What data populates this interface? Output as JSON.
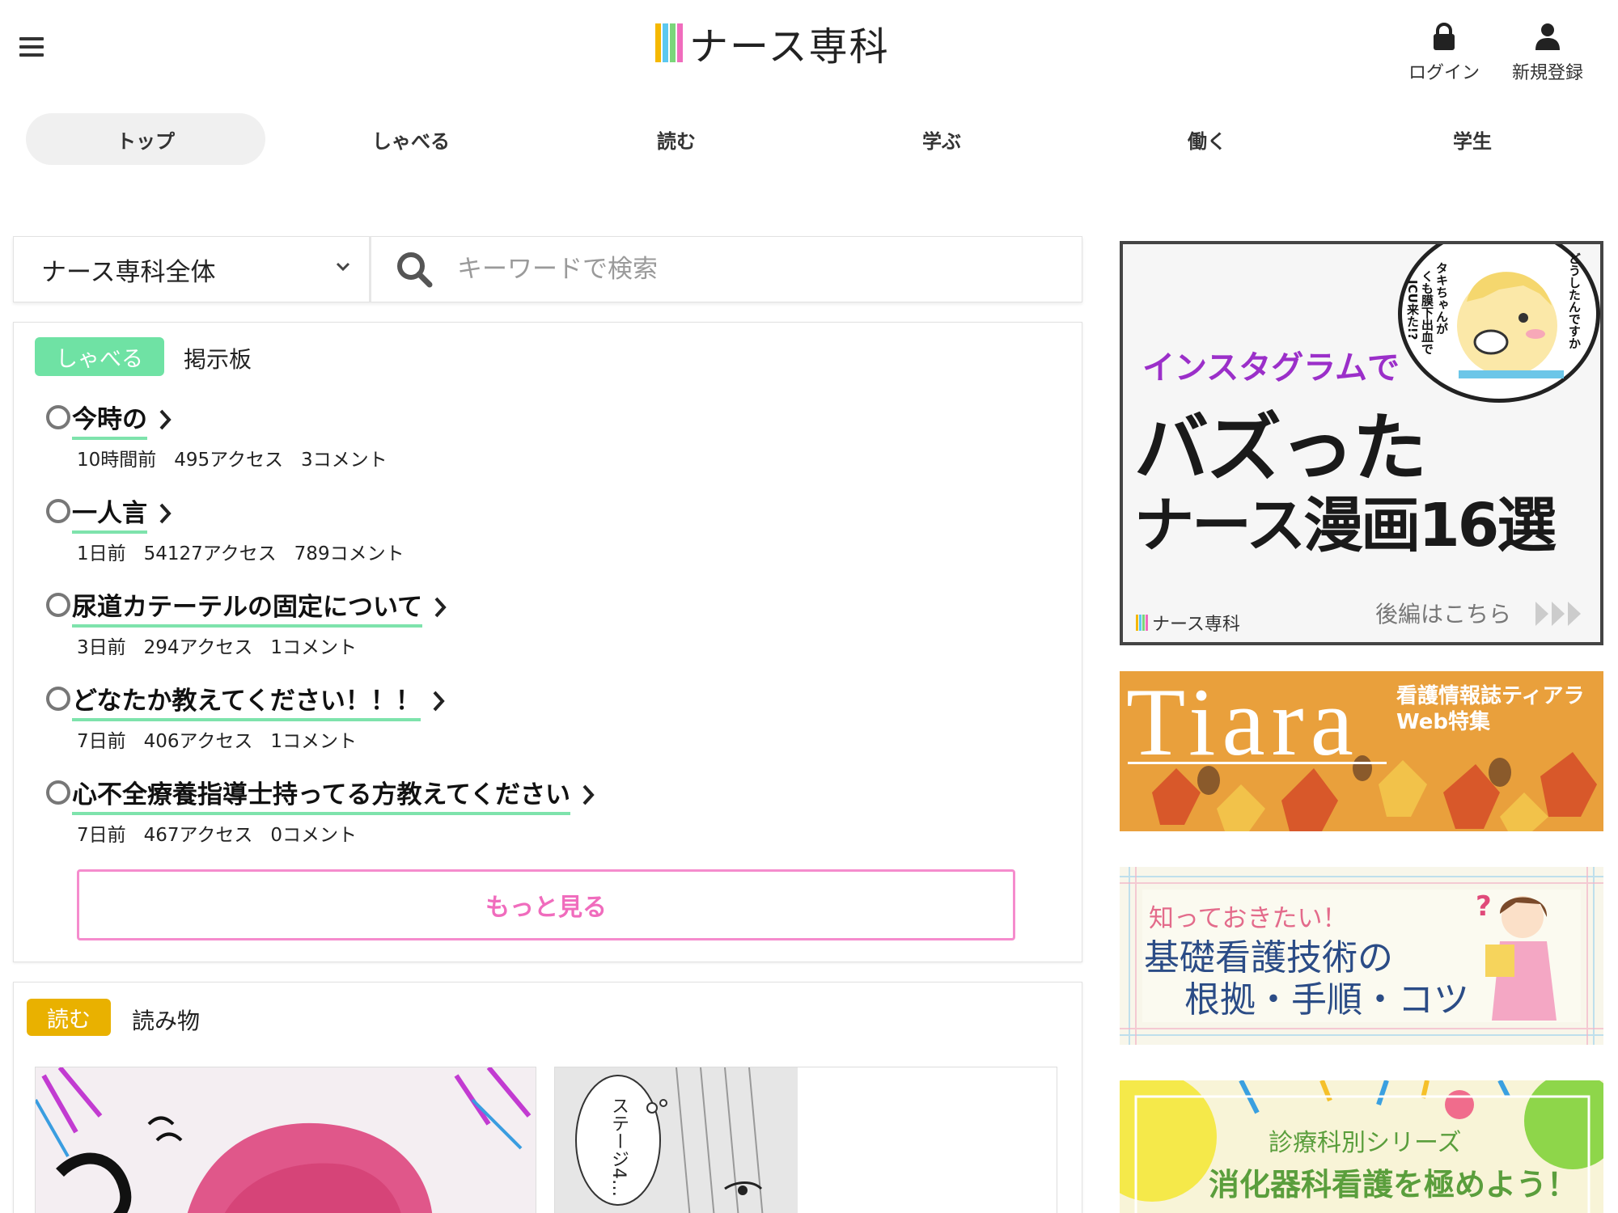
{
  "header": {
    "logo_text": "ナース専科",
    "logo_colors": [
      "#f5b800",
      "#5cc8f0",
      "#7bd67a",
      "#f06cbd"
    ],
    "login_label": "ログイン",
    "signup_label": "新規登録"
  },
  "nav": {
    "tabs": [
      {
        "label": "トップ",
        "active": true
      },
      {
        "label": "しゃべる"
      },
      {
        "label": "読む"
      },
      {
        "label": "学ぶ"
      },
      {
        "label": "働く"
      },
      {
        "label": "学生"
      }
    ]
  },
  "search": {
    "scope_value": "ナース専科全体",
    "placeholder": "キーワードで検索"
  },
  "talk_section": {
    "badge": "しゃべる",
    "subtitle": "掲示板",
    "threads": [
      {
        "title": "今時の",
        "time": "10時間前",
        "access": "495アクセス",
        "comments": "3コメント"
      },
      {
        "title": "一人言",
        "time": "1日前",
        "access": "54127アクセス",
        "comments": "789コメント"
      },
      {
        "title": "尿道カテーテルの固定について",
        "time": "3日前",
        "access": "294アクセス",
        "comments": "1コメント"
      },
      {
        "title": "どなたか教えてください！！！",
        "time": "7日前",
        "access": "406アクセス",
        "comments": "1コメント"
      },
      {
        "title": "心不全療養指導士持ってる方教えてください",
        "time": "7日前",
        "access": "467アクセス",
        "comments": "0コメント"
      }
    ],
    "more_label": "もっと見る"
  },
  "read_section": {
    "badge": "読む",
    "subtitle": "読み物",
    "thumb2_text": "ステージ4…"
  },
  "sidebar": {
    "banner1": {
      "line1": "インスタグラムで",
      "line2": "バズった",
      "line3": "ナース漫画16選",
      "logo": "ナース専科",
      "more": "後編はこちら",
      "speech1": "どうしたんですか",
      "speech2": "タキちゃんが",
      "speech3": "くも膜下出血で",
      "speech4": "ICU来た!?"
    },
    "banner2": {
      "word": "Tiara",
      "line1": "看護情報誌ティアラ",
      "line2": "Web特集"
    },
    "banner3": {
      "line1": "知っておきたい！",
      "line2": "基礎看護技術の",
      "line3": "根拠・手順・コツ"
    },
    "banner4": {
      "line1": "診療科別シリーズ",
      "line2": "消化器科看護を極めよう！"
    }
  }
}
